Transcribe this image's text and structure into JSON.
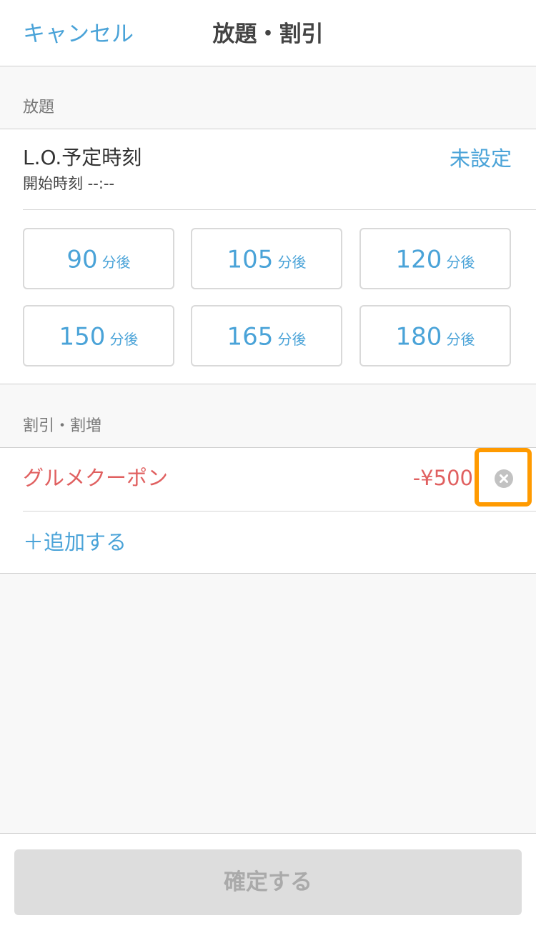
{
  "header": {
    "cancel_label": "キャンセル",
    "title": "放題・割引"
  },
  "all_you_can": {
    "section_label": "放題",
    "lo_title": "L.O.予定時刻",
    "start_time_label": "開始時刻 --:--",
    "status": "未設定",
    "presets": [
      {
        "value": "90",
        "unit": "分後"
      },
      {
        "value": "105",
        "unit": "分後"
      },
      {
        "value": "120",
        "unit": "分後"
      },
      {
        "value": "150",
        "unit": "分後"
      },
      {
        "value": "165",
        "unit": "分後"
      },
      {
        "value": "180",
        "unit": "分後"
      }
    ]
  },
  "discount": {
    "section_label": "割引・割増",
    "items": [
      {
        "name": "グルメクーポン",
        "amount": "-¥500",
        "remove_icon": "close-circle-icon"
      }
    ],
    "add_label": "＋追加する"
  },
  "footer": {
    "confirm_label": "確定する"
  },
  "colors": {
    "accent": "#4aa3d8",
    "discount": "#e06060",
    "highlight": "#ff9a00",
    "disabled_button": "#dddddd"
  }
}
